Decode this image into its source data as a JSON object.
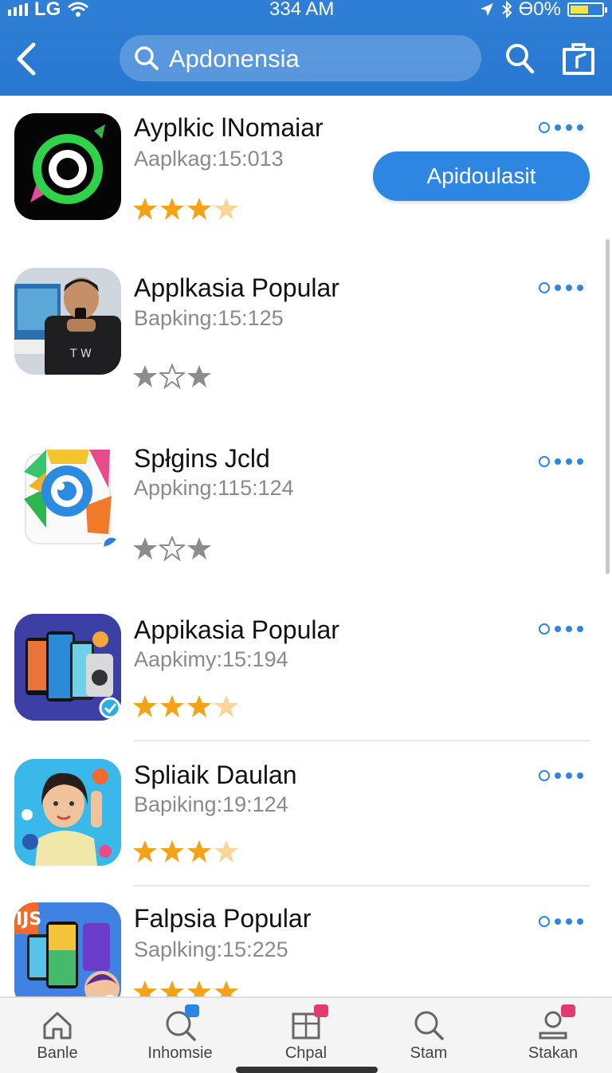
{
  "status_bar": {
    "carrier": "LG",
    "time": "334 AM",
    "battery": "ϴ0%"
  },
  "header": {
    "search_text": "Apdonensia"
  },
  "apps": [
    {
      "name": "Ayplkic lNomaiar",
      "subtitle": "Aaplkag:15:013",
      "rating": 3.5
    },
    {
      "name": "Applkasia Popular",
      "subtitle": "Bapking:15:125",
      "rating": 1.5
    },
    {
      "name": "Spłgins Jcld",
      "subtitle": "Appking:115:124",
      "rating": 1.5
    },
    {
      "name": "Appikasia Popular",
      "subtitle": "Aapkimy:15:194",
      "rating": 3.5
    },
    {
      "name": "Spliaik Daulan",
      "subtitle": "Bapiking:19:124",
      "rating": 3.5
    },
    {
      "name": "Falpsia Popular",
      "subtitle": "Saplking:15:225",
      "rating": 4
    }
  ],
  "install_button": "Apidoulasit",
  "tabs": [
    {
      "label": "Banle"
    },
    {
      "label": "Inhomsie"
    },
    {
      "label": "Chpal"
    },
    {
      "label": "Stam"
    },
    {
      "label": "Stakan"
    }
  ],
  "colors": {
    "header": "#2878d2",
    "accent": "#2d86e1",
    "star_filled": "#f2a31a",
    "star_gray": "#8c8c8c",
    "badge": "#e23a6c"
  }
}
